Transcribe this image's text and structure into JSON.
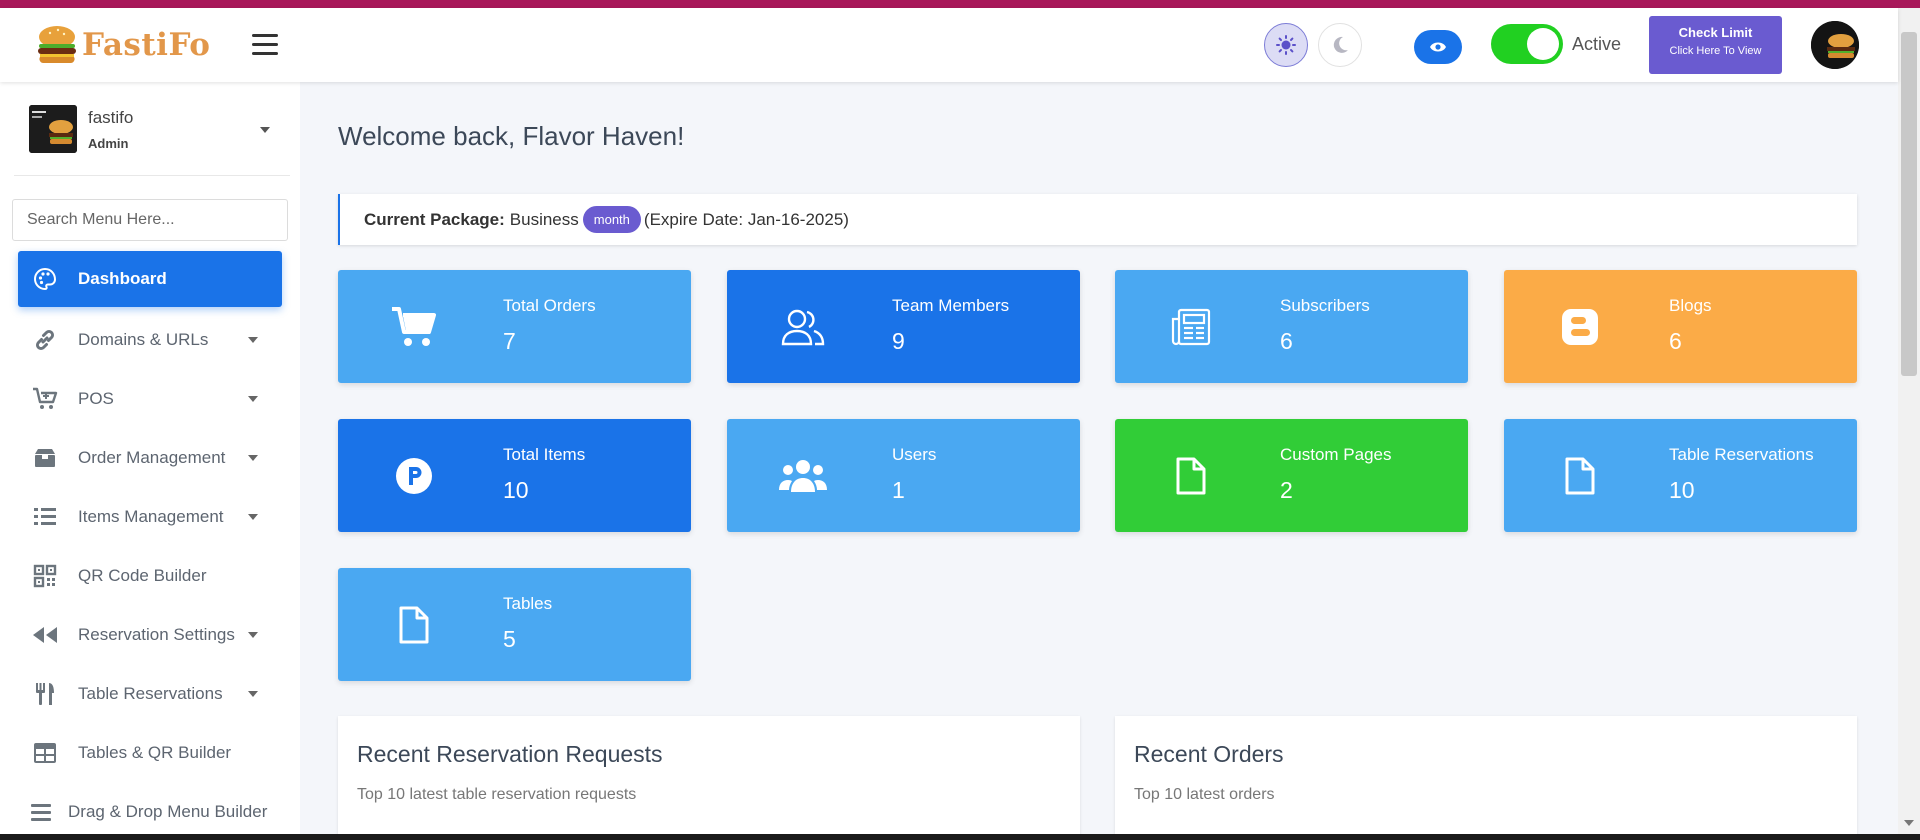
{
  "colors": {
    "top_stripe": "#a8185a",
    "primary_blue": "#1a73e8",
    "light_blue": "#4aa8f2",
    "orange": "#fbab47",
    "green": "#31cd37",
    "purple": "#6a5bd0",
    "toggle_green": "#21d021"
  },
  "header": {
    "logo_text": "FastiFo",
    "status_label": "Active",
    "check_limit_title": "Check Limit",
    "check_limit_sub": "Click Here To View"
  },
  "sidebar": {
    "profile_name": "fastifo",
    "profile_role": "Admin",
    "search_placeholder": "Search Menu Here...",
    "items": [
      {
        "label": "Dashboard",
        "icon": "palette-icon",
        "active": true,
        "caret": false
      },
      {
        "label": "Domains & URLs",
        "icon": "link-icon",
        "active": false,
        "caret": true
      },
      {
        "label": "POS",
        "icon": "cart-plus-icon",
        "active": false,
        "caret": true
      },
      {
        "label": "Order Management",
        "icon": "box-icon",
        "active": false,
        "caret": true
      },
      {
        "label": "Items Management",
        "icon": "list-icon",
        "active": false,
        "caret": true
      },
      {
        "label": "QR Code Builder",
        "icon": "qrcode-icon",
        "active": false,
        "caret": false
      },
      {
        "label": "Reservation Settings",
        "icon": "backward-icon",
        "active": false,
        "caret": true
      },
      {
        "label": "Table Reservations",
        "icon": "utensils-icon",
        "active": false,
        "caret": true
      },
      {
        "label": "Tables & QR Builder",
        "icon": "table-icon",
        "active": false,
        "caret": false
      },
      {
        "label": "Drag & Drop Menu Builder",
        "icon": "bars-icon",
        "active": false,
        "caret": false
      }
    ]
  },
  "main": {
    "welcome": "Welcome back, Flavor Haven!",
    "package_label": "Current Package:",
    "package_name": "Business",
    "package_badge": "month",
    "package_expire": "(Expire Date: Jan-16-2025)",
    "cards": [
      {
        "title": "Total Orders",
        "value": "7",
        "icon": "cart-icon",
        "color": "#4aa8f2"
      },
      {
        "title": "Team Members",
        "value": "9",
        "icon": "user-friends-icon",
        "color": "#1a73e8"
      },
      {
        "title": "Subscribers",
        "value": "6",
        "icon": "newspaper-icon",
        "color": "#4aa8f2"
      },
      {
        "title": "Blogs",
        "value": "6",
        "icon": "blogger-icon",
        "color": "#fbab47"
      },
      {
        "title": "Total Items",
        "value": "10",
        "icon": "parking-circle-icon",
        "color": "#1a73e8"
      },
      {
        "title": "Users",
        "value": "1",
        "icon": "users-icon",
        "color": "#4aa8f2"
      },
      {
        "title": "Custom Pages",
        "value": "2",
        "icon": "file-icon",
        "color": "#31cd37"
      },
      {
        "title": "Table Reservations",
        "value": "10",
        "icon": "file-icon",
        "color": "#4aa8f2"
      },
      {
        "title": "Tables",
        "value": "5",
        "icon": "file-icon",
        "color": "#4aa8f2"
      }
    ],
    "panels": [
      {
        "title": "Recent Reservation Requests",
        "subtitle": "Top 10 latest table reservation requests"
      },
      {
        "title": "Recent Orders",
        "subtitle": "Top 10 latest orders"
      }
    ]
  }
}
